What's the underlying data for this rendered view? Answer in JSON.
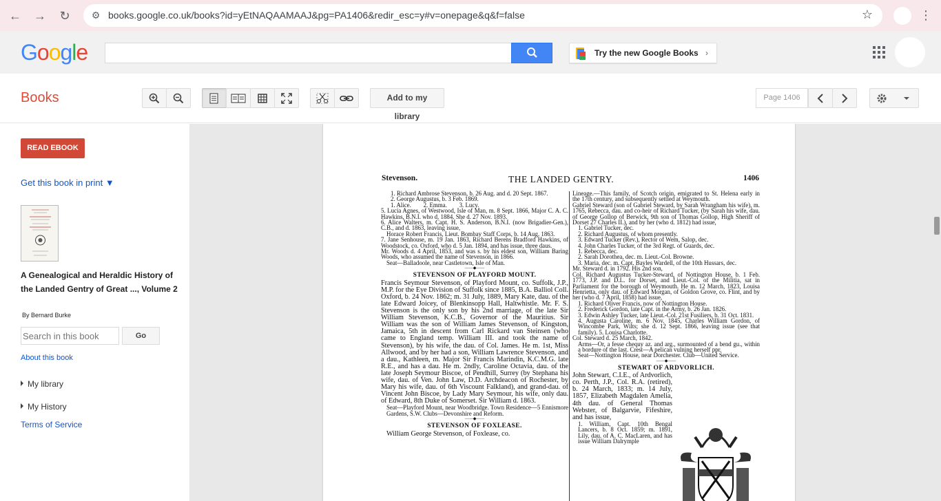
{
  "browser": {
    "url": "books.google.co.uk/books?id=yEtNAQAAMAAJ&pg=PA1406&redir_esc=y#v=onepage&q&f=false"
  },
  "google_bar": {
    "logo_letters": [
      "G",
      "o",
      "o",
      "g",
      "l",
      "e"
    ],
    "logo_colors": [
      "#4285f4",
      "#ea4335",
      "#fbbc05",
      "#4285f4",
      "#34a853",
      "#ea4335"
    ],
    "search_value": "",
    "try_new_label": "Try the new Google Books"
  },
  "toolbar": {
    "title": "Books",
    "add_library_label": "Add to my library",
    "page_indicator": "Page 1406"
  },
  "sidebar": {
    "read_ebook_label": "READ EBOOK",
    "get_book_label": "Get this book in print ▼",
    "book_title": "A Genealogical and Heraldic History of the Landed Gentry of Great ..., Volume 2",
    "author": "By Bernard Burke",
    "search_placeholder": "Search in this book",
    "go_label": "Go",
    "about_label": "About this book",
    "my_library_label": "My library",
    "my_history_label": "My History",
    "terms_label": "Terms of Service"
  },
  "page": {
    "header_left": "Stevenson.",
    "header_center": "THE LANDED GENTRY.",
    "header_right": "1406",
    "left_col": [
      "1. Richard Ambrose Stevenson, b. 26 Aug. and d. 20 Sept. 1867.",
      "2. George Augustus, b. 3 Feb. 1869.",
      "1. Alice.        2. Emma.        3. Lucy.",
      "5. Lucia Agnes, of Westwood, Isle of Man, m. 8 Sept. 1866, Major C. A. C. Hawkins, B.N.I. who d. 1884. She d. 27 Nov. 1893.",
      "6. Alice Walters, m. Capt. H. S. Anderson, B.N.I. (now Brigadier-Gen.), C.B., and d. 1863, leaving issue,",
      "Horace Robert Francis, Lieut. Bombay Staff Corps, b. 14 Aug. 1863.",
      "7. Jane Senhouse, m. 19 Jan. 1863, Richard Berens Bradford Hawkins, of Woodstock, co. Oxford, who d. 5 Jan. 1894, and has issue, three daus.",
      "Mr. Woods d. 4 April, 1853, and was s. by his eldest son, William Baring Woods, who assumed the name of Stevenson, in 1866.",
      "Seat—Balladoole, near Castletown, Isle of Man.",
      "STEVENSON OF PLAYFORD MOUNT.",
      "Francis Seymour Stevenson, of Playford Mount, co. Suffolk, J.P., M.P. for the Eye Division of Suffolk since 1885, B.A. Balliol Coll. Oxford, b. 24 Nov. 1862; m. 31 July, 1889, Mary Kate, dau. of the late Edward Joicey, of Blenkinsopp Hall, Haltwhistle. Mr. F. S. Stevenson is the only son by his 2nd marriage, of the late Sir William Stevenson, K.C.B., Governor of the Mauritius. Sir William was the son of William James Stevenson, of Kingston, Jamaica, 5th in descent from Carl Rickard van Steinsen (who came to England temp. William III. and took the name of Stevenson), by his wife, the dau. of Col. James. He m. 1st, Miss Allwood, and by her had a son, William Lawrence Stevenson, and a dau., Kathleen, m. Major Sir Francis Marindin, K.C.M.G. late R.E., and has a dau. He m. 2ndly, Caroline Octavia, dau. of the late Joseph Seymour Biscoe, of Pendhill, Surrey (by Stephana his wife, dau. of Ven. John Law, D.D. Archdeacon of Rochester, by Mary his wife, dau. of 6th Viscount Falkland), and grand-dau. of Vincent John Biscoe, by Lady Mary Seymour, his wife, only dau. of Edward, 8th Duke of Somerset. Sir William d. 1863.",
      "Seat—Playford Mount, near Woodbridge. Town Residence—5 Ennismore Gardens, S.W. Clubs—Devonshire and Reform.",
      "STEVENSON OF FOXLEASE.",
      "William George Stevenson, of Foxlease, co."
    ],
    "right_col": [
      "Lineage.—This family, of Scotch origin, emigrated to St. Helena early in the 17th century, and subsequently settled at Weymouth.",
      "Gabriel Steward (son of Gabriel Steward, by Sarah Wrangham his wife), m. 1765, Rebecca, dau. and co-heir of Richard Tucker, (by Sarah his wife, dau. of George Gollop of Berwick, 9th son of Thomas Gollop, High Sheriff of Dorset 27 Charles II.), and by her (who d. 1812) had issue,",
      "1. Gabriel Tucker, dec.",
      "2. Richard Augustus, of whom presently.",
      "3. Edward Tucker (Rev.), Rector of Wem, Salop, dec.",
      "4. John Charles Tucker, of the 3rd Regt. of Guards, dec.",
      "1. Rebecca, dec.",
      "2. Sarah Dorothea, dec. m. Lieut.-Col. Browne.",
      "3. Maria, dec. m. Capt. Bayles Wardell, of the 10th Hussars, dec.",
      "Mr. Steward d. in 1792. His 2nd son,",
      "Col. Richard Augustus Tucker-Steward, of Nottington House, b. 1 Feb. 1773, J.P. and D.L. for Dorset, and Lieut.-Col. of the Militia, sat in Parliament for the borough of Weymouth. He m. 12 March, 1823, Louisa Henrietta, only dau. of Edward Morgan, of Goldon Grove, co. Flint, and by her (who d. 7 April, 1858) had issue,",
      "1. Richard Oliver Francis, now of Nottington House.",
      "2. Frederick Gordon, late Capt. in the Army, b. 26 Jan. 1826.",
      "3. Edwin Ashley Tucker, late Lieut.-Col. 21st Fusiliers, b. 31 Oct. 1831.",
      "4. Augusta Caroline, m. 6 Nov. 1845, Charles William Gordon, of Wincombe Park, Wilts; she d. 12 Sept. 1866, leaving issue (see that family).      5. Louisa Charlotte.",
      "Col. Steward d. 25 March, 1842.",
      "Arms—Or, a fesse chequy az. and arg., surmounted of a bend gu., within a bordure of the last. Crest—A pelican vulning herself ppr.",
      "Seat—Nottington House, near Dorchester. Club—United Service.",
      "STEWART OF ARDVORLICH.",
      "John Stewart, C.I.E., of Ardvorlich, co. Perth, J.P., Col. R.A. (retired), b. 24 March, 1833; m. 14 July, 1857, Elizabeth Magdalen Amelia, 4th dau. of General Thomas Webster, of Balgarvie, Fifeshire, and has issue,",
      "1. William, Capt. 10th Bengal Lancers, b. 8 Oct. 1859; m. 1891, Lily, dau. of A. C. MacLaren, and has issue William Dalrymple"
    ]
  }
}
